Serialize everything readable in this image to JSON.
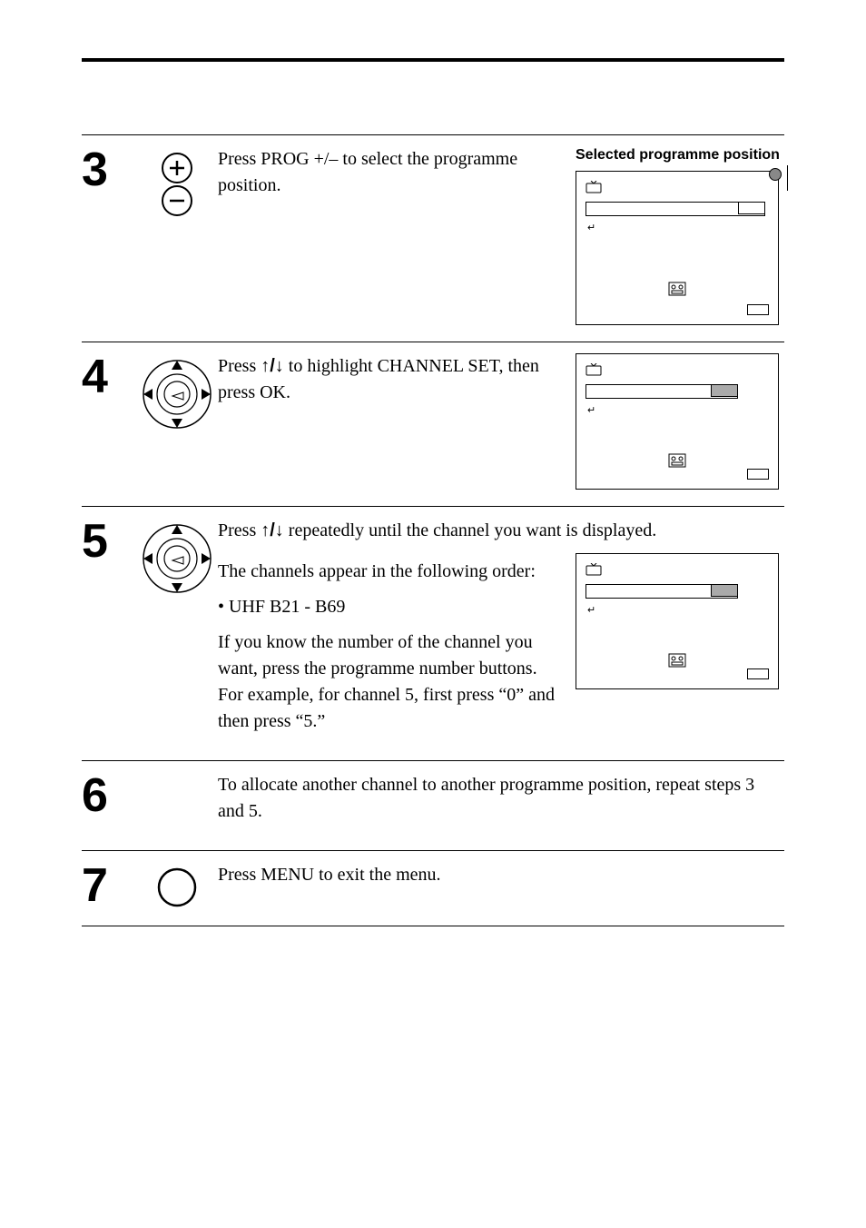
{
  "steps": {
    "s3": {
      "num": "3",
      "text": "Press PROG +/–  to select the programme position.",
      "caption": "Selected programme position"
    },
    "s4": {
      "num": "4",
      "text_pre": "Press ",
      "text_mid": " to highlight CHANNEL SET, then press OK."
    },
    "s5": {
      "num": "5",
      "line1_pre": "Press ",
      "line1_post": " repeatedly until the channel you want is displayed.",
      "para2": "The channels appear in the following order:",
      "bullet": "UHF B21 - B69",
      "para3": "If you know the number of the channel you want, press the programme number buttons.  For example, for channel 5, first press “0” and then press “5.”"
    },
    "s6": {
      "num": "6",
      "text": "To allocate another channel to another programme position, repeat steps 3 and 5."
    },
    "s7": {
      "num": "7",
      "text": "Press MENU to exit the menu."
    }
  },
  "glyphs": {
    "updown": "↑/↓",
    "return": "↵"
  }
}
